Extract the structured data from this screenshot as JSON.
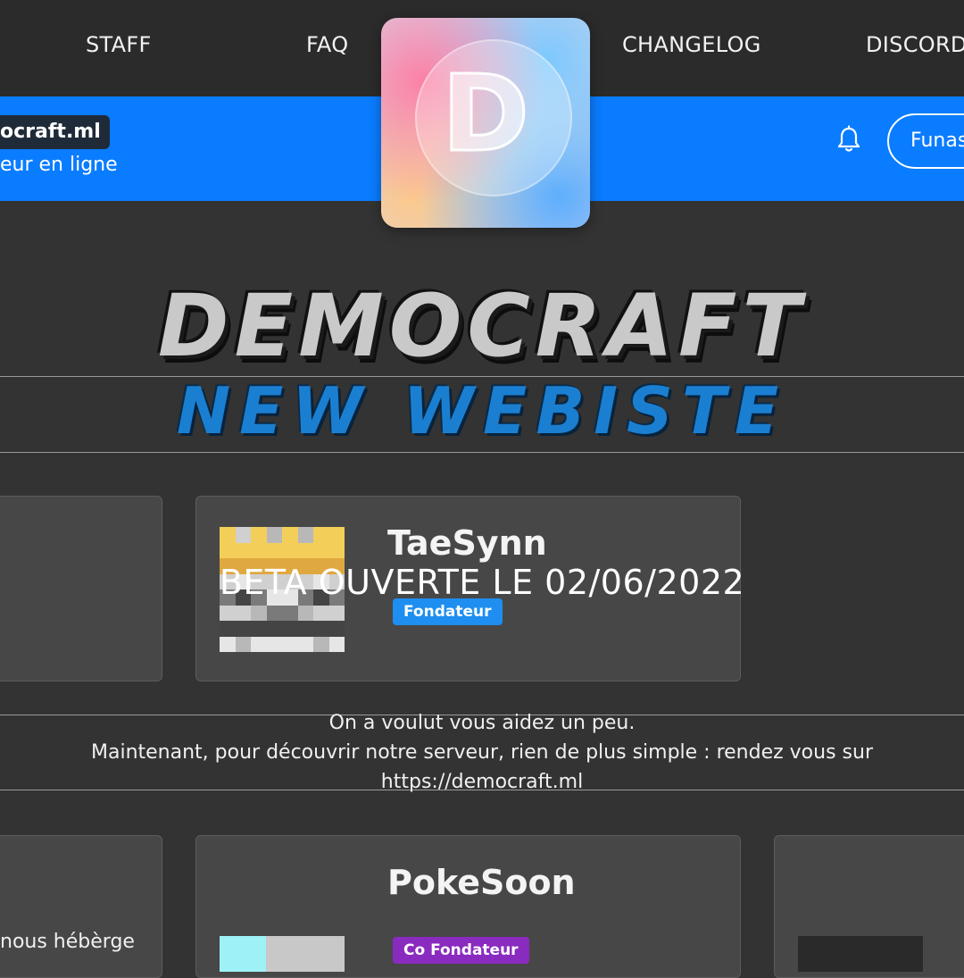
{
  "nav": {
    "items": [
      "STAFF",
      "FAQ",
      "CHANGELOG",
      "DISCORD"
    ]
  },
  "header": {
    "domain": "ocraft.ml",
    "online": "eur en ligne",
    "login_label": "Funas",
    "bell_icon": "bell-icon"
  },
  "logo": {
    "letter": "D"
  },
  "banner": {
    "title": "DEMOCRAFT",
    "subtitle": "NEW WEBISTE"
  },
  "cards": [
    {
      "name": "TaeSynn",
      "role": "Fondateur",
      "role_color": "#1e8ef0"
    },
    {
      "name": "PokeSoon",
      "role": "Co Fondateur",
      "role_color": "#8a2bbf"
    }
  ],
  "overlay": {
    "title": "BETA OUVERTE LE 02/06/2022",
    "line1": "On a voulut vous aidez un peu.",
    "line2": "Maintenant, pour découvrir notre serveur, rien de plus simple : rendez vous sur",
    "line3": "https://democraft.ml"
  },
  "side_text": "nous hébèrge",
  "colors": {
    "accent": "#0a7cff",
    "background": "#333333",
    "topnav": "#2b2b2b",
    "card": "#474747"
  }
}
